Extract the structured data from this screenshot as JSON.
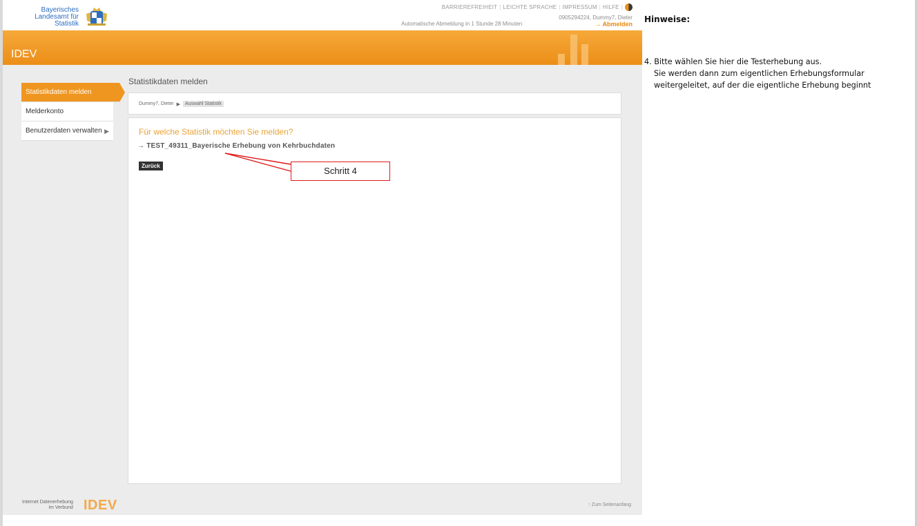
{
  "header": {
    "agency_line1": "Bayerisches Landesamt für",
    "agency_line2": "Statistik",
    "links": [
      "BARRIEREFREIHEIT",
      "LEICHTE SPRACHE",
      "IMPRESSUM",
      "HILFE"
    ],
    "user": "0905294224, Dummy7, Dieter",
    "logout": "Abmelden",
    "auto_logout": "Automatische Abmeldung in 1 Stunde 28 Minuten",
    "app_title": "IDEV"
  },
  "sidebar": {
    "items": [
      {
        "label": "Statistikdaten melden",
        "active": true
      },
      {
        "label": "Melderkonto",
        "active": false
      },
      {
        "label": "Benutzerdaten verwalten",
        "active": false
      }
    ]
  },
  "main": {
    "title": "Statistikdaten melden",
    "breadcrumb": [
      "Dummy7, Dieter",
      "Auswahl Statistik"
    ],
    "question": "Für welche Statistik möchten Sie melden?",
    "statistic": "TEST_49311_Bayerische Erhebung von Kehrbuchdaten",
    "back_button": "Zurück"
  },
  "annotation": {
    "label": "Schritt 4",
    "color": "#e01818"
  },
  "footer": {
    "text_line1": "Internet Datenerhebung",
    "text_line2": "im Verbund",
    "logo": "IDEV",
    "to_top": "Zum Seitenanfang"
  },
  "hints": {
    "title": "Hinweise:",
    "line1": "4. Bitte wählen Sie hier die Testerhebung aus.",
    "line2": "Sie werden dann zum eigentlichen Erhebungsformular",
    "line3": "weitergeleitet, auf der die eigentliche Erhebung beginnt"
  },
  "colors": {
    "accent": "#ef9620",
    "link_blue": "#2a6cc0",
    "question": "#e8a23a"
  }
}
